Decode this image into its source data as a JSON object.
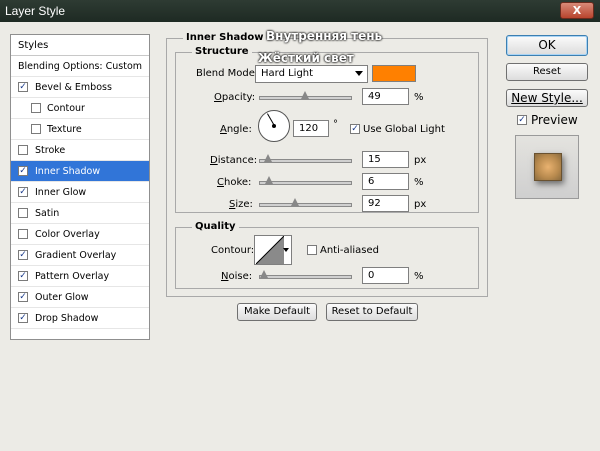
{
  "window": {
    "title": "Layer Style",
    "close_label": "X"
  },
  "overlays": {
    "heading_ru": "Внутренняя тень",
    "blend_ru": "Жёсткий свет"
  },
  "styles_list": {
    "header": "Styles",
    "items": [
      {
        "label": "Blending Options: Custom",
        "checkbox": false,
        "checked": false,
        "selected": false,
        "sub": false
      },
      {
        "label": "Bevel & Emboss",
        "checkbox": true,
        "checked": true,
        "selected": false,
        "sub": false
      },
      {
        "label": "Contour",
        "checkbox": true,
        "checked": false,
        "selected": false,
        "sub": true
      },
      {
        "label": "Texture",
        "checkbox": true,
        "checked": false,
        "selected": false,
        "sub": true
      },
      {
        "label": "Stroke",
        "checkbox": true,
        "checked": false,
        "selected": false,
        "sub": false
      },
      {
        "label": "Inner Shadow",
        "checkbox": true,
        "checked": true,
        "selected": true,
        "sub": false
      },
      {
        "label": "Inner Glow",
        "checkbox": true,
        "checked": true,
        "selected": false,
        "sub": false
      },
      {
        "label": "Satin",
        "checkbox": true,
        "checked": false,
        "selected": false,
        "sub": false
      },
      {
        "label": "Color Overlay",
        "checkbox": true,
        "checked": false,
        "selected": false,
        "sub": false
      },
      {
        "label": "Gradient Overlay",
        "checkbox": true,
        "checked": true,
        "selected": false,
        "sub": false
      },
      {
        "label": "Pattern Overlay",
        "checkbox": true,
        "checked": true,
        "selected": false,
        "sub": false
      },
      {
        "label": "Outer Glow",
        "checkbox": true,
        "checked": true,
        "selected": false,
        "sub": false
      },
      {
        "label": "Drop Shadow",
        "checkbox": true,
        "checked": true,
        "selected": false,
        "sub": false
      }
    ]
  },
  "inner_shadow": {
    "title": "Inner Shadow",
    "structure": {
      "title": "Structure",
      "blend_mode_label": "Blend Mode:",
      "blend_mode_value": "Hard Light",
      "color": "#ff8000",
      "opacity_label": "Opacity:",
      "opacity_value": "49",
      "opacity_fraction": 0.49,
      "angle_label": "Angle:",
      "angle_value": "120",
      "angle_deg": 120,
      "degree_sign": "°",
      "use_global_light_label": "Use Global Light",
      "use_global_light_checked": true,
      "distance_label": "Distance:",
      "distance_value": "15",
      "distance_fraction": 0.05,
      "choke_label": "Choke:",
      "choke_value": "6",
      "choke_fraction": 0.06,
      "size_label": "Size:",
      "size_value": "92",
      "size_fraction": 0.37,
      "unit_px": "px",
      "unit_pct": "%"
    },
    "quality": {
      "title": "Quality",
      "contour_label": "Contour:",
      "anti_aliased_label": "Anti-aliased",
      "anti_aliased_checked": false,
      "noise_label": "Noise:",
      "noise_value": "0",
      "noise_fraction": 0.0
    },
    "make_default_label": "Make Default",
    "reset_default_label": "Reset to Default"
  },
  "right": {
    "ok_label": "OK",
    "reset_label": "Reset",
    "new_style_label": "New Style...",
    "preview_label": "Preview",
    "preview_checked": true
  }
}
